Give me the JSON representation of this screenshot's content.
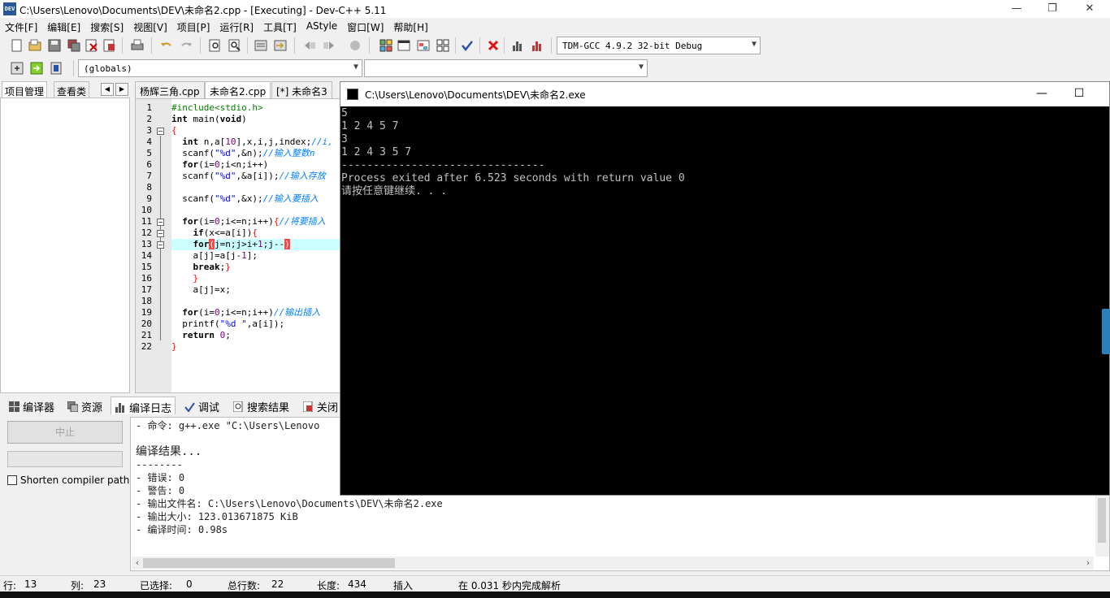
{
  "titlebar": {
    "icon_text": "DEV",
    "title": "C:\\Users\\Lenovo\\Documents\\DEV\\未命名2.cpp - [Executing] - Dev-C++ 5.11",
    "minimize": "—",
    "restore": "❐",
    "close": "✕"
  },
  "menu": [
    "文件[F]",
    "编辑[E]",
    "搜索[S]",
    "视图[V]",
    "项目[P]",
    "运行[R]",
    "工具[T]",
    "AStyle",
    "窗口[W]",
    "帮助[H]"
  ],
  "toolbar": {
    "compiler_select": "TDM-GCC 4.9.2 32-bit Debug",
    "scope_select": "(globals)",
    "function_select": ""
  },
  "left_tabs": [
    "项目管理",
    "查看类"
  ],
  "left_nav": {
    "prev": "◀",
    "next": "▶"
  },
  "editor": {
    "tabs": [
      "杨辉三角.cpp",
      "未命名2.cpp",
      "[*] 未命名3"
    ],
    "line_numbers": [
      "1",
      "2",
      "3",
      "4",
      "5",
      "6",
      "7",
      "8",
      "9",
      "10",
      "11",
      "12",
      "13",
      "14",
      "15",
      "16",
      "17",
      "18",
      "19",
      "20",
      "21",
      "22"
    ]
  },
  "bottom_tabs": [
    "编译器",
    "资源",
    "编译日志",
    "调试",
    "搜索结果",
    "关闭"
  ],
  "compile_panel": {
    "stop_button": "中止",
    "shorten_label": "Shorten compiler paths",
    "log": [
      "- 命令: g++.exe \"C:\\Users\\Lenovo",
      "",
      "编译结果...",
      "--------",
      "- 错误: 0",
      "- 警告: 0",
      "- 输出文件名: C:\\Users\\Lenovo\\Documents\\DEV\\未命名2.exe",
      "- 输出大小: 123.013671875 KiB",
      "- 编译时间: 0.98s"
    ]
  },
  "statusbar": {
    "row_label": "行:",
    "row": "13",
    "col_label": "列:",
    "col": "23",
    "sel_label": "已选择:",
    "sel": "0",
    "total_label": "总行数:",
    "total": "22",
    "len_label": "长度:",
    "len": "434",
    "mode": "插入",
    "parse": "在 0.031 秒内完成解析"
  },
  "console": {
    "title": "C:\\Users\\Lenovo\\Documents\\DEV\\未命名2.exe",
    "minimize": "—",
    "maximize": "☐",
    "lines": [
      "5",
      "1 2 4 5 7",
      "3",
      "1 2 4 3 5 7",
      "--------------------------------",
      "Process exited after 6.523 seconds with return value 0",
      "请按任意键继续. . ."
    ]
  },
  "colors": {
    "keyword": "#000000",
    "preprocessor": "#008000",
    "comment": "#0080ff",
    "string": "#0000ff",
    "symbol": "#ff0000",
    "highlight_line": "#ccffff",
    "console_bg": "#000000",
    "console_text": "#c0c0c0"
  }
}
